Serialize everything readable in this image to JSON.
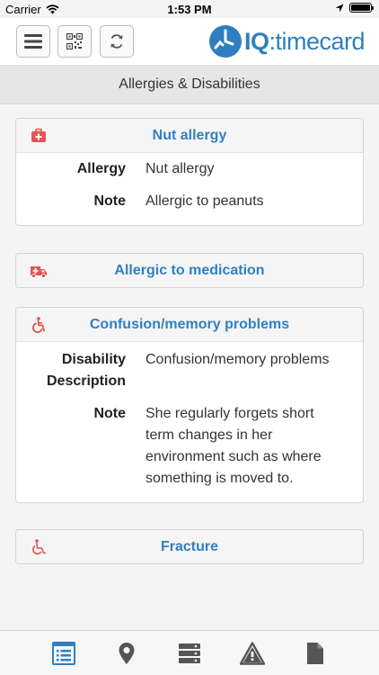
{
  "status_bar": {
    "carrier": "Carrier",
    "time": "1:53 PM"
  },
  "header": {
    "logo": {
      "part1": "IQ",
      "part2": ":timecard"
    }
  },
  "page_title": "Allergies & Disabilities",
  "colors": {
    "accent": "#2f80c3",
    "alert_icon": "#e05555",
    "tab_active": "#2f80c3",
    "tab_inactive": "#555555"
  },
  "cards": [
    {
      "icon": "medical-kit-icon",
      "title": "Nut allergy",
      "rows": [
        {
          "label": "Allergy",
          "value": "Nut allergy"
        },
        {
          "label": "Note",
          "value": "Allergic to peanuts"
        }
      ]
    },
    {
      "icon": "ambulance-icon",
      "title": "Allergic to medication"
    },
    {
      "icon": "wheelchair-active-icon",
      "title": "Confusion/memory problems",
      "rows": [
        {
          "label": "Disability Description",
          "value": "Confusion/memory problems"
        },
        {
          "label": "Note",
          "value": "She regularly forgets short term changes in her environment such as where something is moved to."
        }
      ]
    },
    {
      "icon": "wheelchair-icon",
      "title": "Fracture"
    }
  ],
  "tabs": [
    {
      "icon": "list-icon",
      "active": true
    },
    {
      "icon": "map-marker-icon",
      "active": false
    },
    {
      "icon": "server-icon",
      "active": false
    },
    {
      "icon": "warning-icon",
      "active": false
    },
    {
      "icon": "document-icon",
      "active": false
    }
  ]
}
